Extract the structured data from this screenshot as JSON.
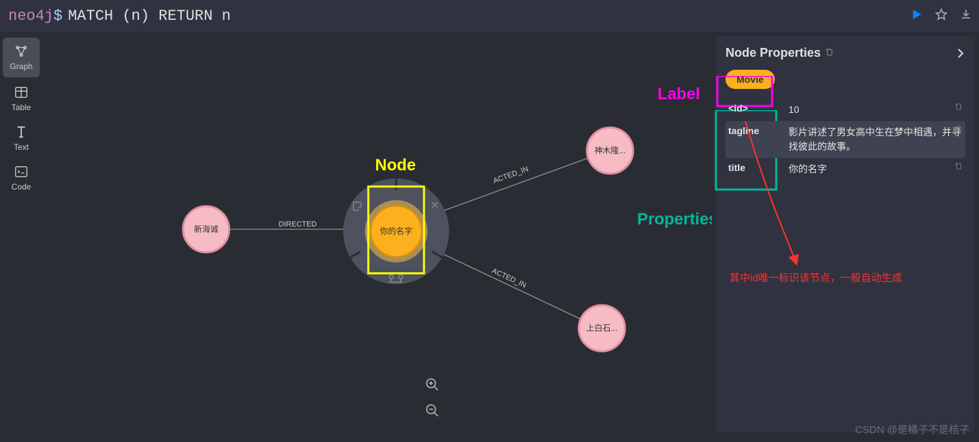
{
  "prompt": {
    "neo4j": "neo4j",
    "dollar": "$",
    "query": "MATCH (n) RETURN n"
  },
  "sidebar": {
    "items": [
      {
        "label": "Graph"
      },
      {
        "label": "Table"
      },
      {
        "label": "Text"
      },
      {
        "label": "Code"
      }
    ]
  },
  "graph": {
    "center": {
      "label": "你的名字"
    },
    "nodes": {
      "left": {
        "label": "新海诚"
      },
      "topright": {
        "label": "神木隆..."
      },
      "bottomright": {
        "label": "上白石..."
      }
    },
    "edges": {
      "left": "DIRECTED",
      "topright": "ACTED_IN",
      "bottomright": "ACTED_IN"
    }
  },
  "annotations": {
    "node": "Node",
    "label": "Label",
    "properties": "Properties",
    "note": "其中id唯一标识该节点，一般自动生成"
  },
  "panel": {
    "title": "Node Properties",
    "label": "Movie",
    "props": [
      {
        "key": "<id>",
        "value": "10"
      },
      {
        "key": "tagline",
        "value": "影片讲述了男女高中生在梦中相遇，并寻找彼此的故事。"
      },
      {
        "key": "title",
        "value": "你的名字"
      }
    ]
  },
  "watermark": "CSDN @是橘子不是桔子"
}
